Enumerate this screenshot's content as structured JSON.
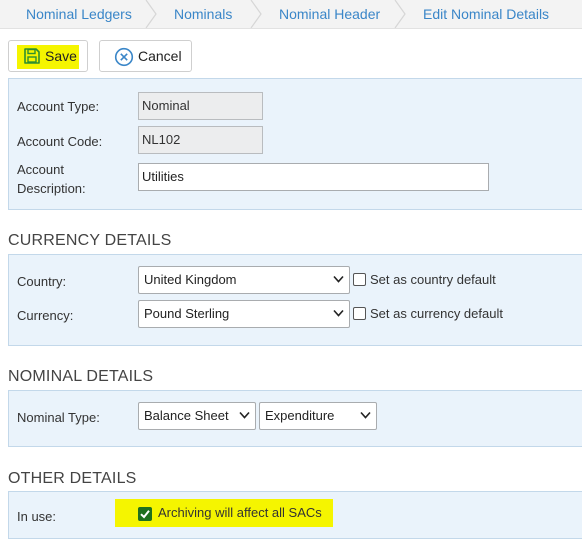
{
  "breadcrumb": {
    "items": [
      "Nominal Ledgers",
      "Nominals",
      "Nominal Header",
      "Edit Nominal Details"
    ]
  },
  "toolbar": {
    "save_label": "Save",
    "cancel_label": "Cancel"
  },
  "account": {
    "type_label": "Account Type:",
    "type_value": "Nominal",
    "code_label": "Account Code:",
    "code_value": "NL102",
    "description_label_line1": "Account",
    "description_label_line2": "Description:",
    "description_value": "Utilities"
  },
  "currency_details": {
    "title": "CURRENCY DETAILS",
    "country_label": "Country:",
    "country_value": "United Kingdom",
    "country_default_label": "Set as country default",
    "currency_label": "Currency:",
    "currency_value": "Pound Sterling",
    "currency_default_label": "Set as currency default"
  },
  "nominal_details": {
    "title": "NOMINAL DETAILS",
    "type_label": "Nominal Type:",
    "type_value_1": "Balance Sheet",
    "type_value_2": "Expenditure"
  },
  "other_details": {
    "title": "OTHER DETAILS",
    "in_use_label": "In use:",
    "archiving_label": "Archiving will affect all SACs",
    "archiving_checked": true
  },
  "colors": {
    "accent": "#3a86c8",
    "panel_bg": "#eaf3fb",
    "highlight": "#f5f500",
    "checkbox_checked": "#1e6f1e"
  }
}
